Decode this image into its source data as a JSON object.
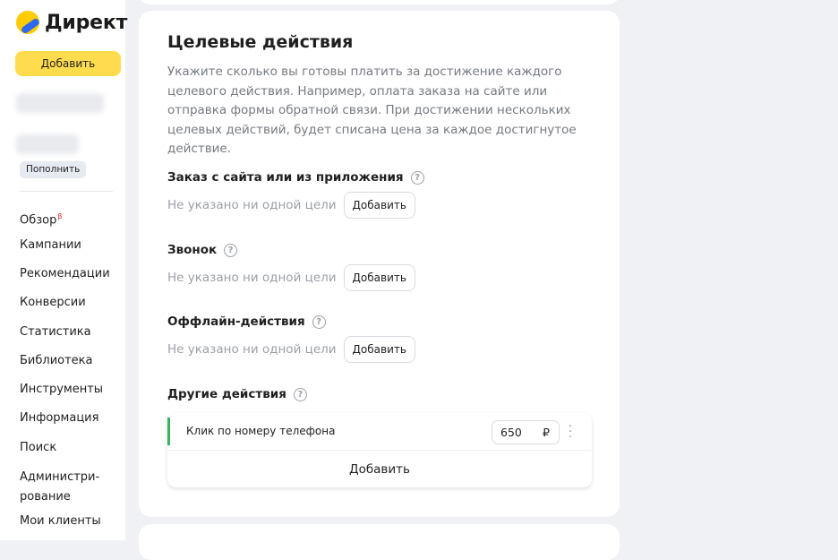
{
  "sidebar": {
    "logo_text": "Директ",
    "add_button": "Добавить",
    "topup_button": "Пополнить",
    "nav": [
      {
        "label": "Обзор",
        "badge": "β"
      },
      {
        "label": "Кампании"
      },
      {
        "label": "Рекомендации"
      },
      {
        "label": "Конверсии"
      },
      {
        "label": "Статистика"
      },
      {
        "label": "Библиотека"
      },
      {
        "label": "Инструменты"
      },
      {
        "label": "Информация"
      },
      {
        "label": "Поиск"
      },
      {
        "label": "Администри-\nрование"
      },
      {
        "label": "Мои клиенты"
      }
    ]
  },
  "main": {
    "title": "Целевые действия",
    "description": "Укажите сколько вы готовы платить за достижение каждого целевого действия. Например, оплата заказа на сайте или отправка формы обратной связи. При достижении нескольких целевых действий, будет списана цена за каждое достигнутое действие.",
    "sections": [
      {
        "title": "Заказ с сайта или из приложения",
        "empty_text": "Не указано ни одной цели",
        "add_label": "Добавить"
      },
      {
        "title": "Звонок",
        "empty_text": "Не указано ни одной цели",
        "add_label": "Добавить"
      },
      {
        "title": "Оффлайн-действия",
        "empty_text": "Не указано ни одной цели",
        "add_label": "Добавить"
      }
    ],
    "other": {
      "title": "Другие действия",
      "action": {
        "label": "Клик по номеру телефона",
        "price": "650",
        "currency": "₽"
      },
      "add_label": "Добавить"
    },
    "help_glyph": "?"
  },
  "colors": {
    "accent_yellow": "#ffdc4d",
    "active_green": "#3bb35a",
    "background": "#eff1f5"
  }
}
